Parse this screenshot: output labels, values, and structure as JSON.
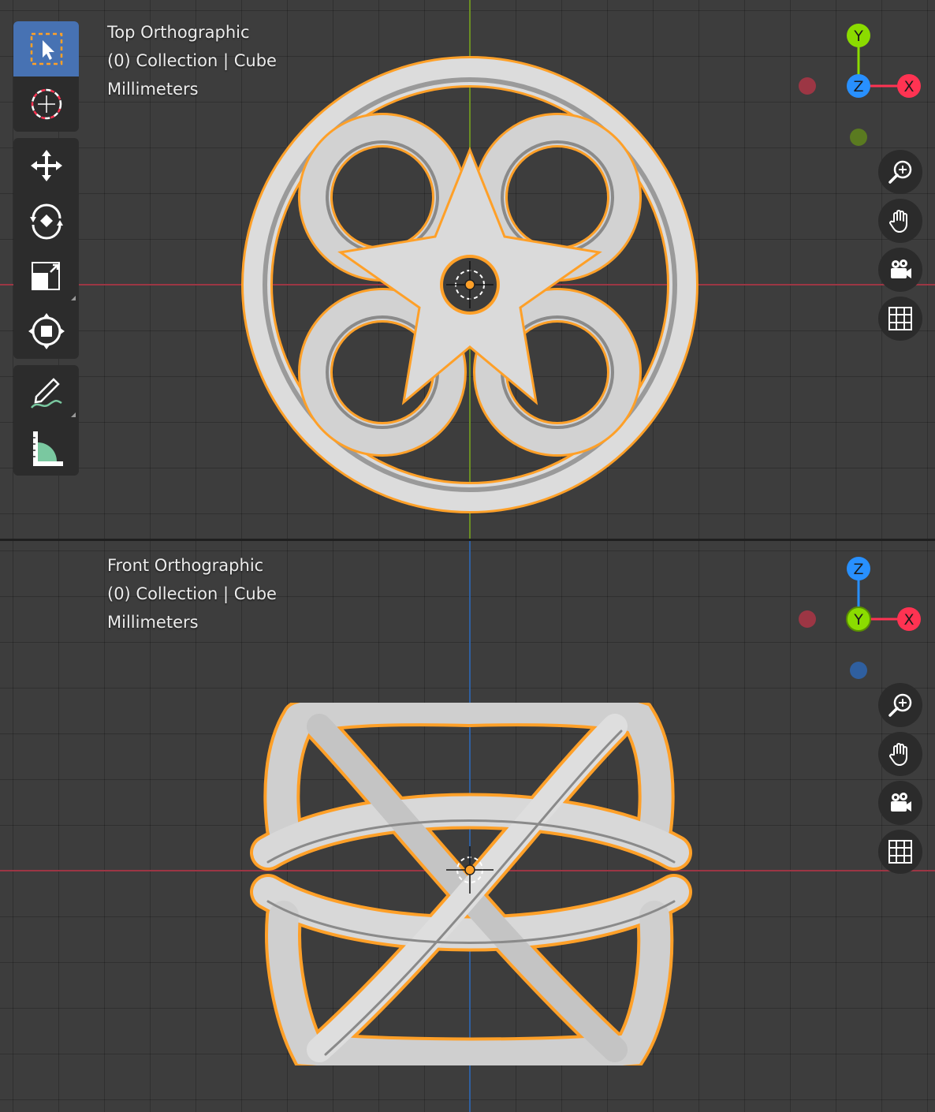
{
  "viewports": {
    "top": {
      "view_name": "Top Orthographic",
      "collection_info": "(0) Collection | Cube",
      "units": "Millimeters",
      "axes": {
        "up": "Y",
        "center": "Z",
        "right": "X"
      }
    },
    "front": {
      "view_name": "Front Orthographic",
      "collection_info": "(0) Collection | Cube",
      "units": "Millimeters",
      "axes": {
        "up": "Z",
        "center": "Y",
        "right": "X"
      }
    }
  },
  "toolbar": {
    "tools": [
      "select-box",
      "cursor",
      "move",
      "rotate",
      "scale",
      "transform",
      "annotate",
      "measure"
    ],
    "active_tool": "select-box"
  },
  "navigation": [
    "zoom-icon",
    "pan-hand-icon",
    "camera-icon",
    "grid-icon"
  ],
  "colors": {
    "background": "#3d3d3d",
    "grid": "#333333",
    "x_axis": "#ff3352",
    "y_axis": "#8bdc00",
    "z_axis": "#2890ff",
    "selection_outline": "#ffa028",
    "active_tool": "#4772b3"
  }
}
